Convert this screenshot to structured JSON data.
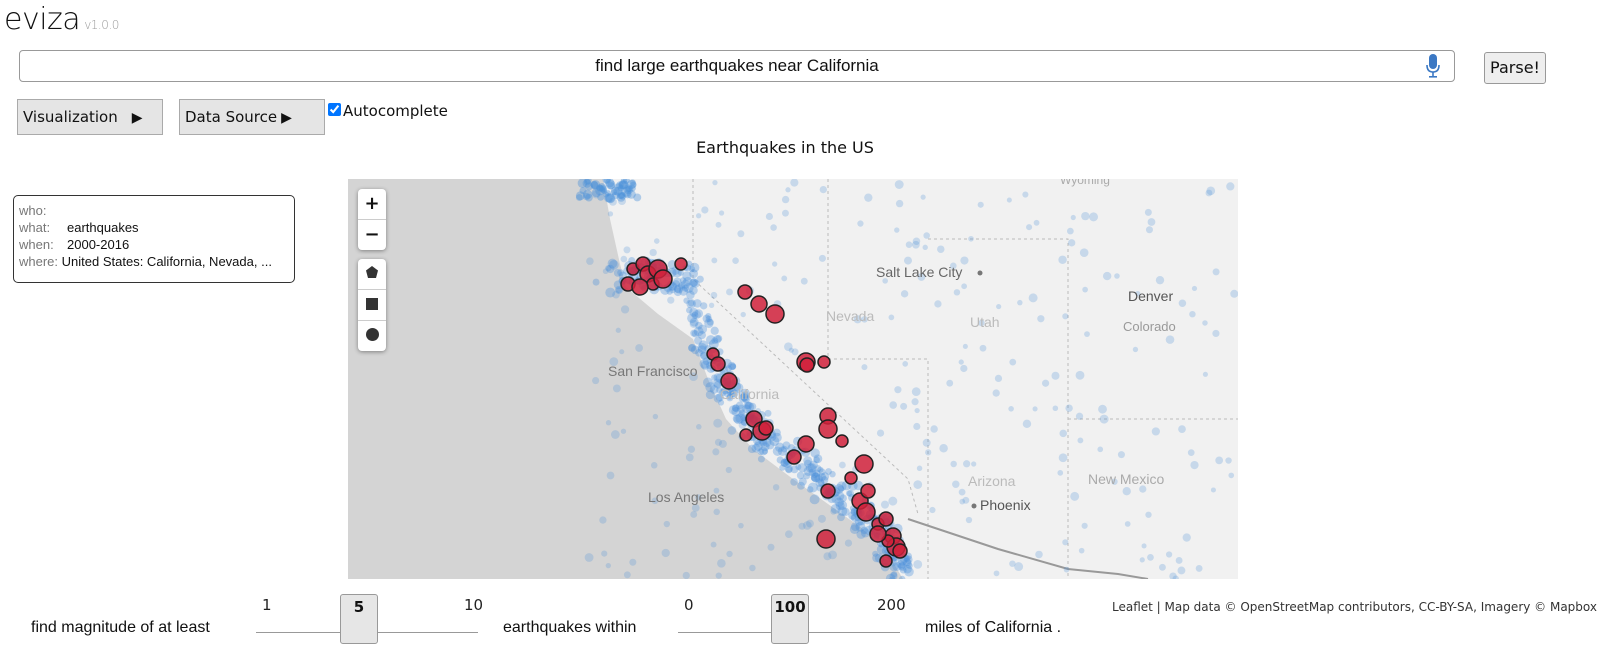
{
  "app": {
    "name": "eviza",
    "version": "v1.0.0"
  },
  "query": {
    "value": "find large earthquakes near California",
    "mic_icon": "microphone-icon",
    "parse_label": "Parse!"
  },
  "toolbar": {
    "visualization_label": "Visualization",
    "data_source_label": "Data Source",
    "arrow": "▶",
    "autocomplete_label": "Autocomplete",
    "autocomplete_checked": true
  },
  "chart": {
    "title": "Earthquakes in the US"
  },
  "info": {
    "who_label": "who:",
    "who": "",
    "what_label": "what:",
    "what": "earthquakes",
    "when_label": "when:",
    "when": "2000-2016",
    "where_label": "where:",
    "where": "United States: California, Nevada, ..."
  },
  "map": {
    "zoom_in": "+",
    "zoom_out": "−",
    "tools": [
      "pentagon-icon",
      "square-icon",
      "circle-icon"
    ],
    "labels": [
      "Wyoming",
      "Salt Lake City",
      "Denver",
      "Nevada",
      "Utah",
      "Colorado",
      "San Francisco",
      "California",
      "Los Angeles",
      "Arizona",
      "Phoenix",
      "New Mexico"
    ],
    "colors": {
      "quake": "#4a90d9",
      "large_quake": "#d0213b",
      "ocean": "#d4d4d4",
      "land": "#f1f1f1"
    },
    "attribution": "Leaflet | Map data © OpenStreetMap contributors, CC-BY-SA, Imagery © Mapbox"
  },
  "controls": {
    "magnitude_prefix": "find magnitude of at least",
    "magnitude": {
      "min": "1",
      "value": "5",
      "max": "10"
    },
    "distance_prefix": "earthquakes within",
    "distance": {
      "min": "0",
      "value": "100",
      "max": "200"
    },
    "suffix": "miles of California ."
  }
}
